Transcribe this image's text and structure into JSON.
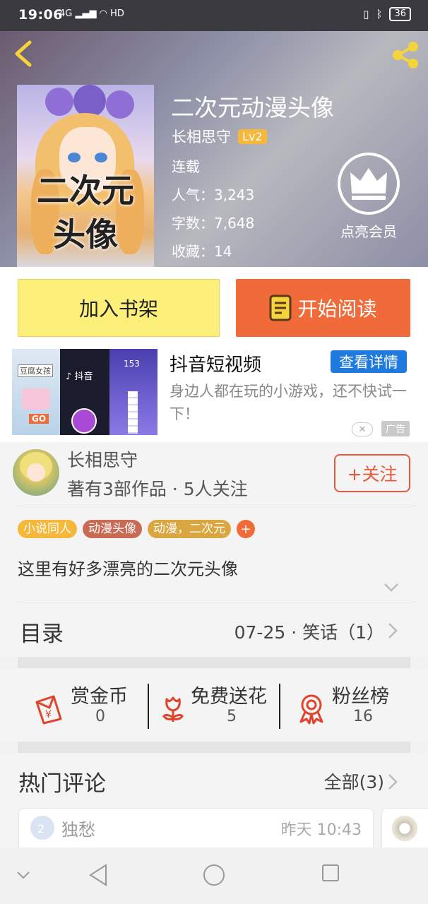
{
  "status_bar": {
    "time": "19:06",
    "signal_text": "4G",
    "hd": "HD",
    "battery": "36"
  },
  "header": {
    "cover_text_line1": "二次元",
    "cover_text_line2": "头像",
    "title": "二次元动漫头像",
    "author": "长相思守",
    "author_level": "Lv2",
    "status": "连载",
    "popularity_label": "人气：",
    "popularity": "3,243",
    "word_count_label": "字数：",
    "word_count": "7,648",
    "favorites_label": "收藏：",
    "favorites": "14",
    "vip_label": "点亮会员"
  },
  "buttons": {
    "add_shelf": "加入书架",
    "start_reading": "开始阅读"
  },
  "ad": {
    "title": "抖音短视频",
    "cta": "查看详情",
    "description": "身边人都在玩的小游戏，还不快试一下！",
    "tag": "广告",
    "img_text_1": "豆腐女孩",
    "img_text_2": "抖音",
    "img_text_3": "GO",
    "img_text_4": "153"
  },
  "author_block": {
    "name": "长相思守",
    "stats": "著有3部作品 · 5人关注",
    "follow": "+关注",
    "tags": [
      {
        "label": "小说同人",
        "color": "#f5b83a"
      },
      {
        "label": "动漫头像",
        "color": "#c96a55"
      },
      {
        "label": "动漫，二次元",
        "color": "#d9a640"
      }
    ],
    "tag_add": "+",
    "description": "这里有好多漂亮的二次元头像"
  },
  "toc": {
    "title": "目录",
    "latest": "07-25 · 笑话（1）"
  },
  "stats": [
    {
      "label": "赏金币",
      "value": "0",
      "icon": "red-envelope-icon"
    },
    {
      "label": "免费送花",
      "value": "5",
      "icon": "flower-icon"
    },
    {
      "label": "粉丝榜",
      "value": "16",
      "icon": "medal-icon"
    }
  ],
  "hot_comments": {
    "title": "热门评论",
    "all": "全部(3)",
    "first": {
      "name": "独愁",
      "time": "昨天 10:43"
    }
  },
  "colors": {
    "accent_orange": "#f06a3a",
    "shelf_yellow": "#fdf07a",
    "ad_blue": "#1f7ae0",
    "icon_yellow": "#f5d33a"
  }
}
